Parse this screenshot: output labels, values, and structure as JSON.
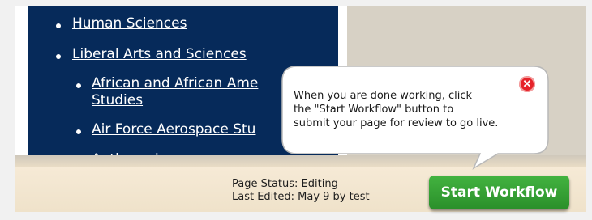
{
  "menu": {
    "items": [
      {
        "label": "Human Sciences"
      },
      {
        "label": "Liberal Arts and Sciences"
      },
      {
        "label": "African and African Ame",
        "label2": "Studies"
      },
      {
        "label": "Air Force Aerospace Stu"
      },
      {
        "label": "Anthropology"
      }
    ]
  },
  "tooltip": {
    "line1": "When you are done working, click",
    "line2": "the \"Start Workflow\" button to",
    "line3": "submit your page for review to go live.",
    "close_icon": "close-icon"
  },
  "footer": {
    "page_status": "Page Status: Editing",
    "last_edited": "Last Edited: May 9 by test",
    "start_button": "Start Workflow"
  },
  "colors": {
    "navy": "#062a5a",
    "button_green": "#2f9a30",
    "close_red": "#e6232a",
    "footer_bg": "#f3e6ce"
  }
}
